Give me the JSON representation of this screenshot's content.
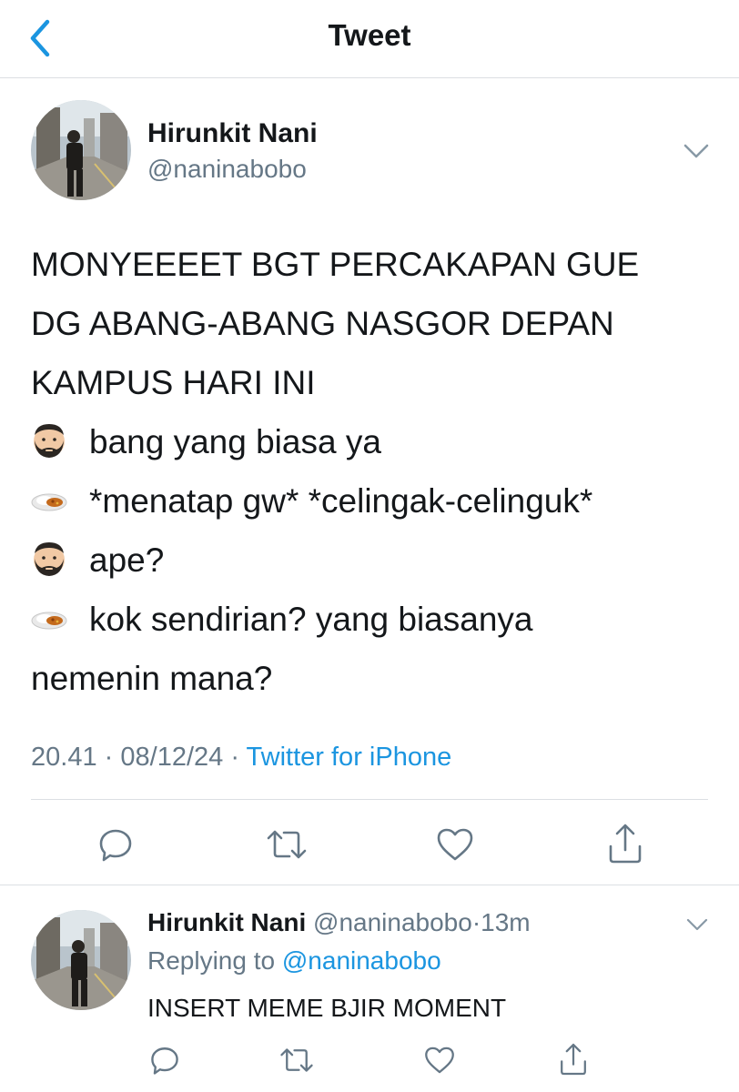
{
  "header": {
    "title": "Tweet",
    "back_icon": "chevron-left-icon"
  },
  "colors": {
    "accent": "#1b95e0",
    "secondary_text": "#657786",
    "primary_text": "#14171a",
    "divider": "#dcdfe3"
  },
  "tweet": {
    "author_name": "Hirunkit Nani",
    "author_handle": "@naninabobo",
    "lines": [
      {
        "emoji": "",
        "text": "MONYEEEET BGT PERCAKAPAN GUE"
      },
      {
        "emoji": "",
        "text": "DG ABANG-ABANG NASGOR DEPAN"
      },
      {
        "emoji": "",
        "text": "KAMPUS HARI INI"
      },
      {
        "emoji": "bearded-man-emoji",
        "text": "bang yang biasa ya"
      },
      {
        "emoji": "curry-rice-emoji",
        "text": "*menatap gw* *celingak-celinguk*"
      },
      {
        "emoji": "bearded-man-emoji",
        "text": "ape?"
      },
      {
        "emoji": "curry-rice-emoji",
        "text": "kok sendirian? yang biasanya"
      },
      {
        "emoji": "",
        "text": "nemenin mana?"
      }
    ],
    "time": "20.41",
    "date": "08/12/24",
    "separator": "·",
    "source": "Twitter for iPhone",
    "actions": [
      "reply-icon",
      "retweet-icon",
      "like-icon",
      "share-icon"
    ]
  },
  "reply": {
    "author_name": "Hirunkit Nani",
    "author_handle": "@naninabobo",
    "separator": "·",
    "age": "13m",
    "replying_prefix": "Replying to",
    "replying_to": "@naninabobo",
    "text": "INSERT MEME BJIR MOMENT",
    "actions": [
      "reply-icon",
      "retweet-icon",
      "like-icon",
      "share-icon"
    ]
  }
}
